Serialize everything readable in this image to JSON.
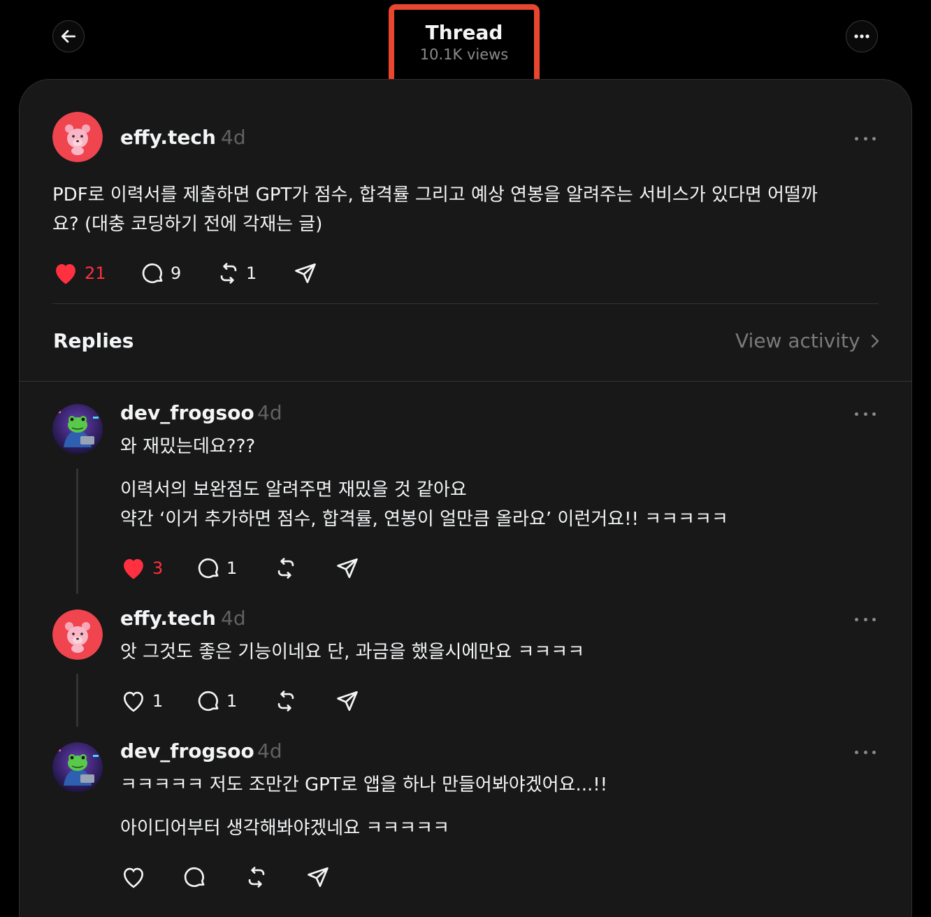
{
  "header": {
    "title": "Thread",
    "views": "10.1K views",
    "back_icon": "arrow-left-icon",
    "more_icon": "ellipsis-icon"
  },
  "post": {
    "username": "effy.tech",
    "time": "4d",
    "text_line1": "PDF로 이력서를 제출하면 GPT가 점수, 합격률 그리고 예상 연봉을 알려주는 서비스가 있다면 어떨까",
    "text_line2": "요? (대충 코딩하기 전에 각재는 글)",
    "likes": "21",
    "comments": "9",
    "reposts": "1",
    "liked": true
  },
  "replies_header": {
    "label": "Replies",
    "view_activity": "View activity"
  },
  "replies": [
    {
      "username": "dev_frogsoo",
      "time": "4d",
      "line1": "와 재밌는데요???",
      "line2": "이력서의 보완점도 알려주면 재밌을 것 같아요",
      "line3": "약간 ‘이거 추가하면 점수, 합격률, 연봉이 얼만큼 올라요’ 이런거요!! ㅋㅋㅋㅋㅋ",
      "likes": "3",
      "comments": "1",
      "liked": true
    },
    {
      "username": "effy.tech",
      "time": "4d",
      "line1": "앗 그것도 좋은 기능이네요 단, 과금을 했을시에만요 ㅋㅋㅋㅋ",
      "likes": "1",
      "comments": "1",
      "liked": false
    },
    {
      "username": "dev_frogsoo",
      "time": "4d",
      "line1": "ㅋㅋㅋㅋㅋ 저도 조만간 GPT로 앱을 하나 만들어봐야겠어요...!!",
      "line2": "아이디어부터 생각해봐야겠네요 ㅋㅋㅋㅋㅋ",
      "liked": false
    }
  ],
  "colors": {
    "background": "#000000",
    "card": "#181818",
    "like_red": "#ff3040",
    "highlight_box": "#e8462f",
    "muted_text": "#616161"
  }
}
